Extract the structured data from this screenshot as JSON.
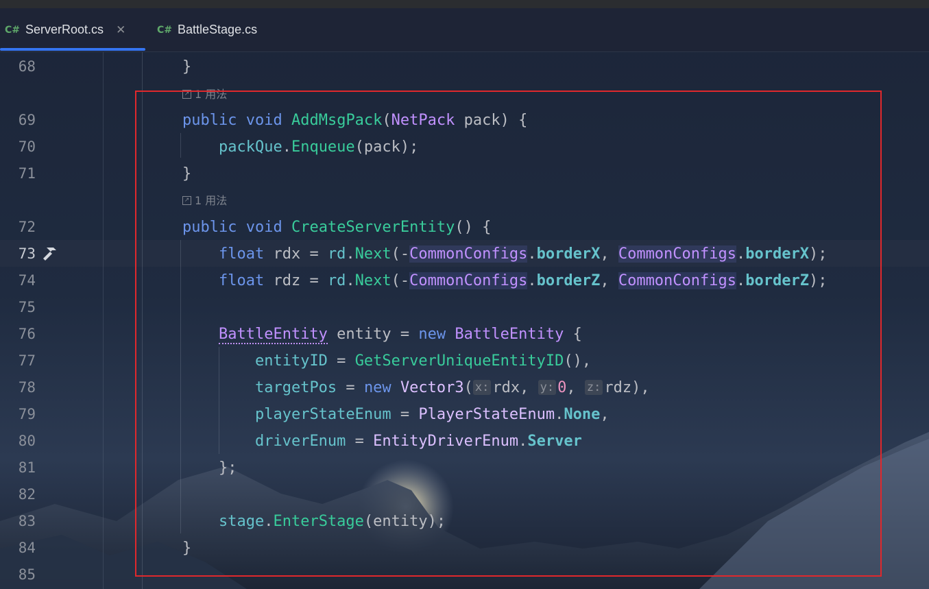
{
  "colors": {
    "keyword": "#6c95eb",
    "function": "#39cc9b",
    "type": "#c191ff",
    "field": "#66c3cc",
    "number": "#ed94c0",
    "plain": "#bcbec4",
    "highlight_box": "#e0282c",
    "active_tab_underline": "#3574f0"
  },
  "tabs": [
    {
      "lang": "C#",
      "label": "ServerRoot.cs",
      "active": true,
      "close_glyph": "✕"
    },
    {
      "lang": "C#",
      "label": "BattleStage.cs",
      "active": false
    }
  ],
  "usage_hint": "1 用法",
  "line_numbers": {
    "l68": "68",
    "l69": "69",
    "l70": "70",
    "l71": "71",
    "l72": "72",
    "l73": "73",
    "l74": "74",
    "l75": "75",
    "l76": "76",
    "l77": "77",
    "l78": "78",
    "l79": "79",
    "l80": "80",
    "l81": "81",
    "l82": "82",
    "l83": "83",
    "l84": "84",
    "l85": "85"
  },
  "active_line": 73,
  "gutter_icon": "hammer-icon",
  "code": {
    "brace_close": "}",
    "public": "public",
    "void": "void",
    "float": "float",
    "new": "new",
    "AddMsgPack": "AddMsgPack",
    "NetPack": "NetPack",
    "pack": "pack",
    "open_paren_pack": " pack) {",
    "packQue": "packQue",
    "Enqueue": "Enqueue",
    "enqueue_args": "(pack);",
    "CreateServerEntity": "CreateServerEntity",
    "create_tail": "() {",
    "rdx_decl": " rdx = ",
    "rdz_decl": " rdz = ",
    "rd": "rd",
    "dot": ".",
    "Next": "Next",
    "open_neg": "(-",
    "CommonConfigs": "CommonConfigs",
    "borderX": "borderX",
    "borderZ": "borderZ",
    "comma_sp": ", ",
    "close_semi": ");",
    "BattleEntity": "BattleEntity",
    "entity_decl": " entity = ",
    "open_brace": " {",
    "entityID": "entityID",
    "assign": " = ",
    "GetServerUniqueEntityID": "GetServerUniqueEntityID",
    "call_comma": "(),",
    "targetPos": "targetPos",
    "Vector3": "Vector3",
    "paren_open": "(",
    "hint_x": "x:",
    "rdx": "rdx",
    "hint_y": "y:",
    "zero": "0",
    "hint_z": "z:",
    "rdz": "rdz",
    "vec_close": "),",
    "playerStateEnum": "playerStateEnum",
    "PlayerStateEnum": "PlayerStateEnum",
    "None": "None",
    "comma": ",",
    "driverEnum": "driverEnum",
    "EntityDriverEnum": "EntityDriverEnum",
    "Server": "Server",
    "init_close": "};",
    "stage": "stage",
    "EnterStage": "EnterStage",
    "enter_args": "(entity);"
  }
}
